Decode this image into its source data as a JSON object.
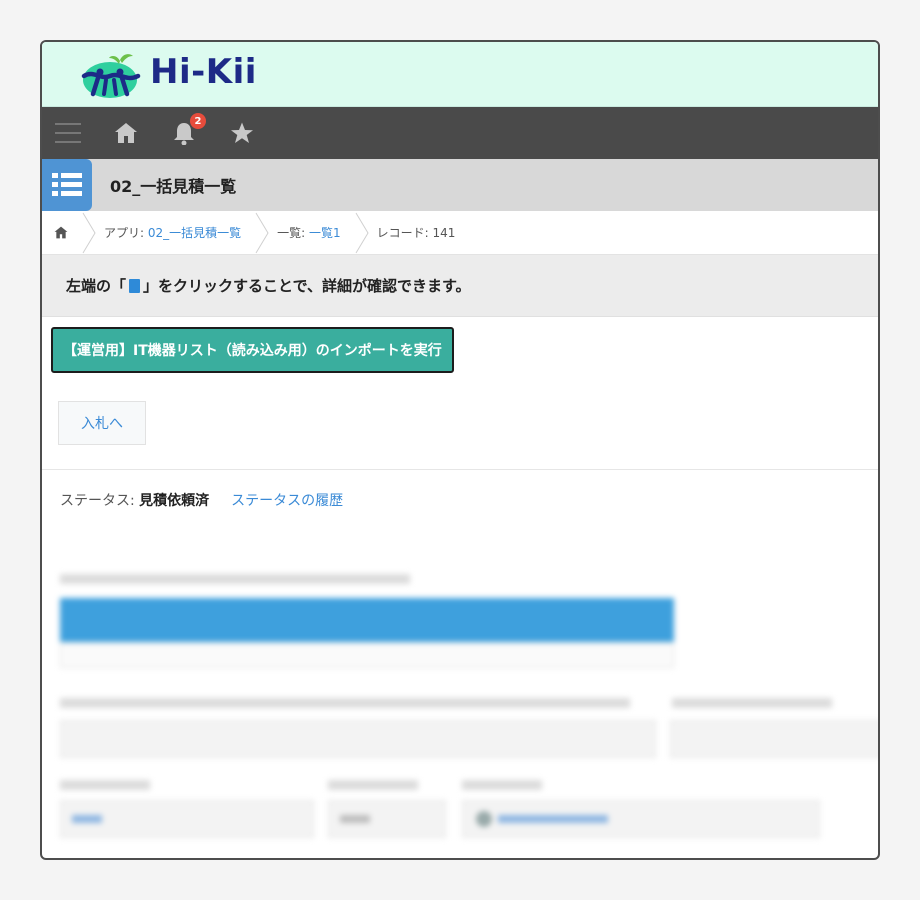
{
  "brand": {
    "name": "Hi-Kii"
  },
  "toolbar": {
    "notification_count": "2"
  },
  "app": {
    "title": "02_一括見積一覧"
  },
  "breadcrumb": {
    "app_prefix": "アプリ: ",
    "app_link": "02_一括見積一覧",
    "view_prefix": "一覧: ",
    "view_link": "一覧1",
    "record": "レコード: 141"
  },
  "notice": {
    "before": "左端の「",
    "after": "」をクリックすることで、詳細が確認できます。"
  },
  "actions": {
    "import_label": "【運営用】IT機器リスト（読み込み用）のインポートを実行",
    "bid_label": "入札へ"
  },
  "status": {
    "label": "ステータス: ",
    "value": "見積依頼済",
    "history_link": "ステータスの履歴"
  },
  "colors": {
    "brand_bg": "#dcfbef",
    "toolbar_bg": "#4a4a4a",
    "accent_teal": "#3aae9e",
    "link_blue": "#3a8ad6",
    "badge_red": "#e74c3c"
  }
}
